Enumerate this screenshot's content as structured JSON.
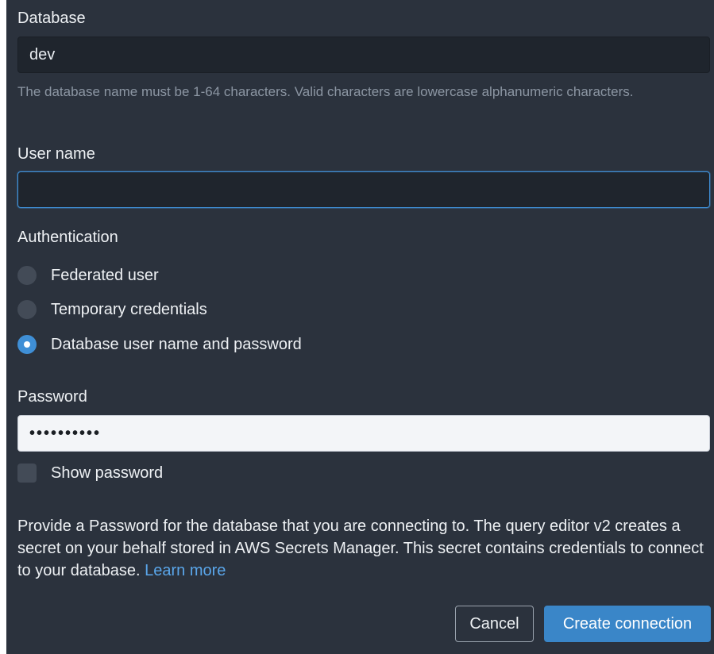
{
  "database": {
    "label": "Database",
    "value": "dev",
    "hint": "The database name must be 1-64 characters. Valid characters are lowercase alphanumeric characters."
  },
  "username": {
    "label": "User name",
    "value": ""
  },
  "authentication": {
    "label": "Authentication",
    "options": [
      {
        "label": "Federated user",
        "checked": false
      },
      {
        "label": "Temporary credentials",
        "checked": false
      },
      {
        "label": "Database user name and password",
        "checked": true
      }
    ]
  },
  "password": {
    "label": "Password",
    "masked_value": "••••••••••",
    "show_password_label": "Show password",
    "show_password_checked": false
  },
  "description": {
    "text": "Provide a Password for the database that you are connecting to. The query editor v2 creates a secret on your behalf stored in AWS Secrets Manager. This secret contains credentials to connect to your database.",
    "link_text": "Learn more"
  },
  "buttons": {
    "cancel": "Cancel",
    "create": "Create connection"
  },
  "colors": {
    "panel_background": "#2b323d",
    "accent": "#3a86c8",
    "link": "#5aa6ea"
  }
}
